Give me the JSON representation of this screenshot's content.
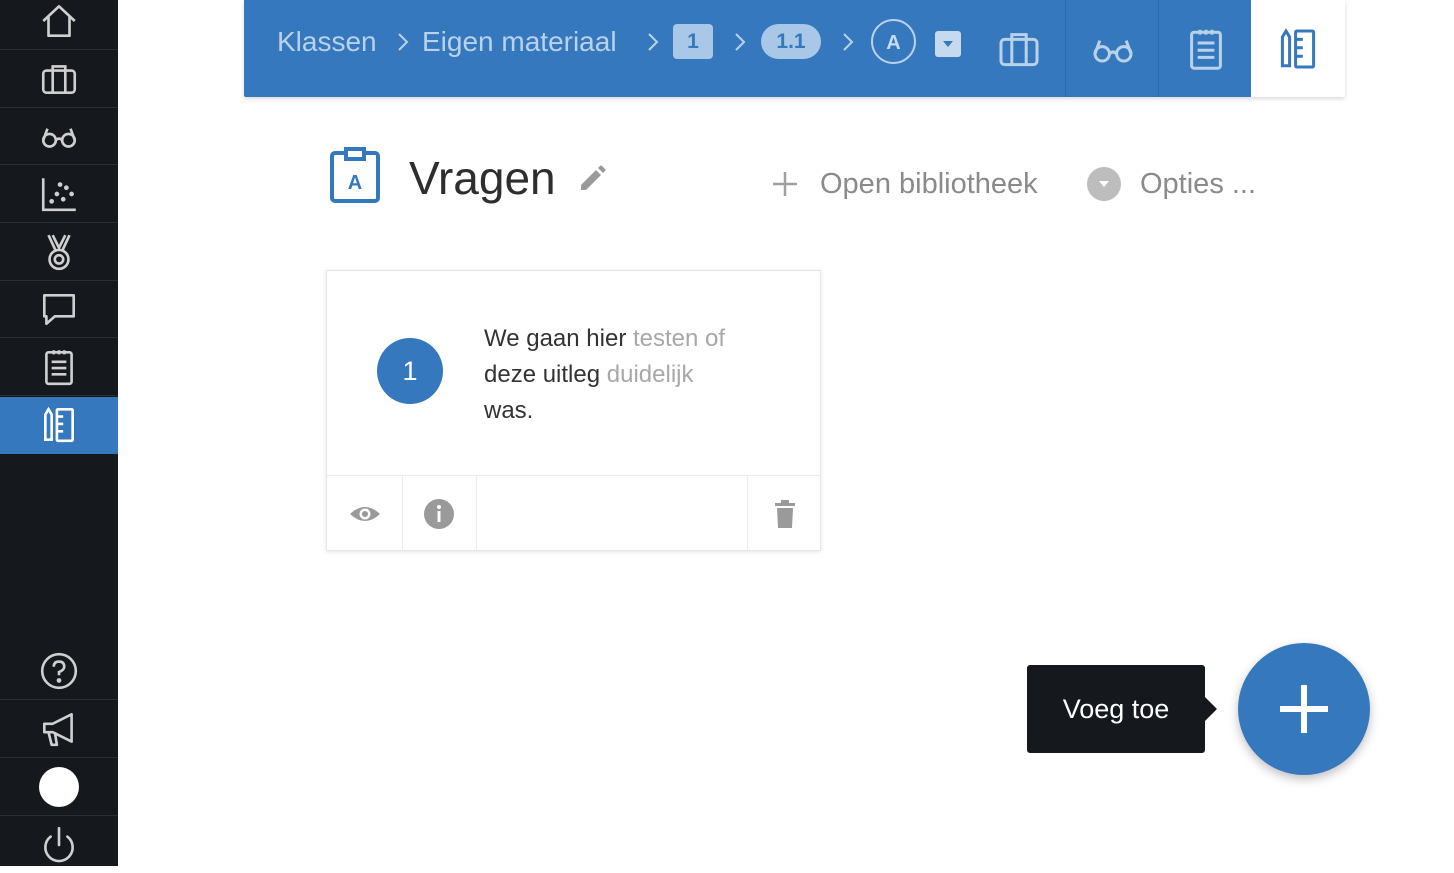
{
  "breadcrumb": {
    "items": [
      "Klassen",
      "Eigen materiaal"
    ],
    "chips": [
      "1",
      "1.1",
      "A"
    ]
  },
  "header": {
    "title": "Vragen",
    "open_library": "Open bibliotheek",
    "options": "Opties ..."
  },
  "card": {
    "number": "1",
    "text_parts": [
      "We gaan ",
      "hier ",
      "testen of",
      "deze uitleg ",
      "duidelijk",
      "was."
    ]
  },
  "fab": {
    "tooltip": "Voeg toe"
  },
  "colors": {
    "accent": "#3578bd",
    "sidebar": "#15191e"
  }
}
